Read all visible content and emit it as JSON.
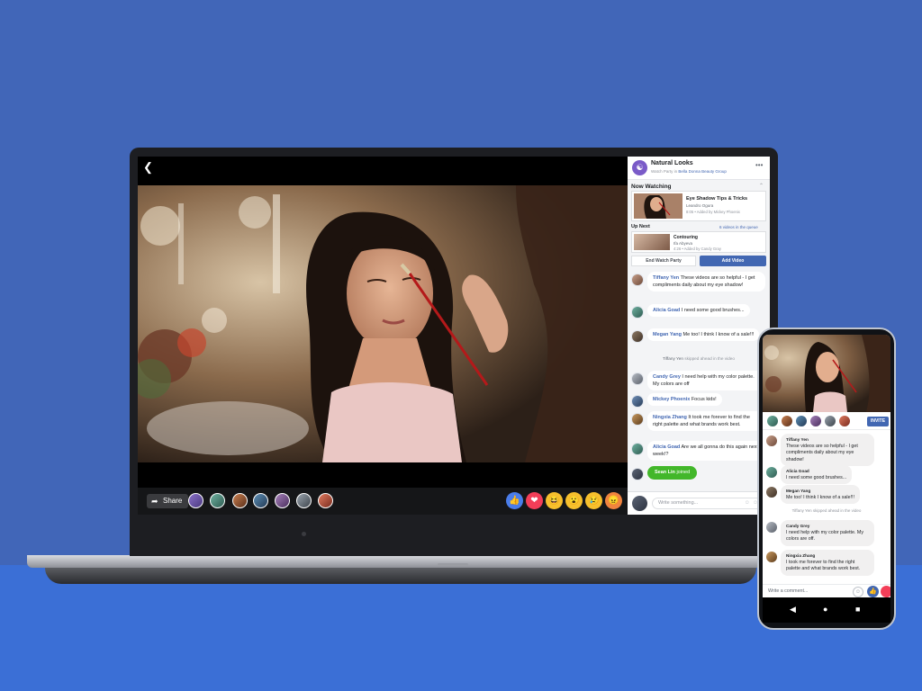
{
  "colors": {
    "background": "#4166b8",
    "floor": "#3b6fd6",
    "brand_blue": "#4267b2",
    "joined_green": "#42b72a"
  },
  "video": {
    "back_icon": "chevron-left-icon"
  },
  "video_bar": {
    "share_label": "Share",
    "reactions": [
      "like",
      "love",
      "haha",
      "wow",
      "sad",
      "angry"
    ]
  },
  "panel": {
    "group_name": "Natural Looks",
    "group_sub_prefix": "Watch Party in",
    "group_sub_link": "Bella Donna Beauty Group",
    "now_watching_label": "Now Watching",
    "now_watching": {
      "title": "Eye Shadow Tips & Tricks",
      "author": "Leandro Ogura",
      "meta": "8:05 • Added by Mickey Phoenix"
    },
    "up_next_label": "Up Next",
    "queue_count": "6 videos in the queue",
    "up_next": {
      "title": "Contouring",
      "author": "Ifa Abyeva",
      "meta": "4:26 • Added by Candy Gray"
    },
    "end_button": "End Watch Party",
    "add_button": "Add Video",
    "messages": [
      {
        "name": "Tiffany Yen",
        "text": "These videos are so helpful - I get compliments daily about my eye shadow!"
      },
      {
        "name": "Alicia Goad",
        "text": "I need some good brushes..."
      },
      {
        "name": "Megan Yang",
        "text": "Me too! I think I know of a sale!!!"
      },
      {
        "name": "Candy Grey",
        "text": "I need help with my color palette. My colors are off"
      },
      {
        "name": "Mickey Phoenix",
        "text": "Focus kids!"
      },
      {
        "name": "Ningxia Zhang",
        "text": "It took me forever to find the right palette and what brands work best."
      },
      {
        "name": "Alicia Goad",
        "text": "Are we all gonna do this again next week!?"
      }
    ],
    "system_message": {
      "name": "Tiffany Yen",
      "text": "skipped ahead in the video"
    },
    "joined": {
      "name": "Sean Lin",
      "text": "joined"
    },
    "compose_placeholder": "Write something..."
  },
  "phone": {
    "invite_label": "INVITE",
    "messages": [
      {
        "name": "Tiffany Yen",
        "text": "These videos are so helpful - I get compliments daily about my eye shadow!"
      },
      {
        "name": "Alicia Goad",
        "text": "I need some good brushes..."
      },
      {
        "name": "Megan Yang",
        "text": "Me too! I think I know of a sale!!!"
      },
      {
        "name": "Candy Grey",
        "text": "I need help with my color palette. My colors are off."
      },
      {
        "name": "Ningxia Zhang",
        "text": "I took me forever to find the right palette and what brands work best."
      }
    ],
    "system_message": {
      "name": "Tiffany Yen",
      "text": "skipped ahead in the video"
    },
    "compose_placeholder": "Write a comment...",
    "notification_count": "3"
  }
}
